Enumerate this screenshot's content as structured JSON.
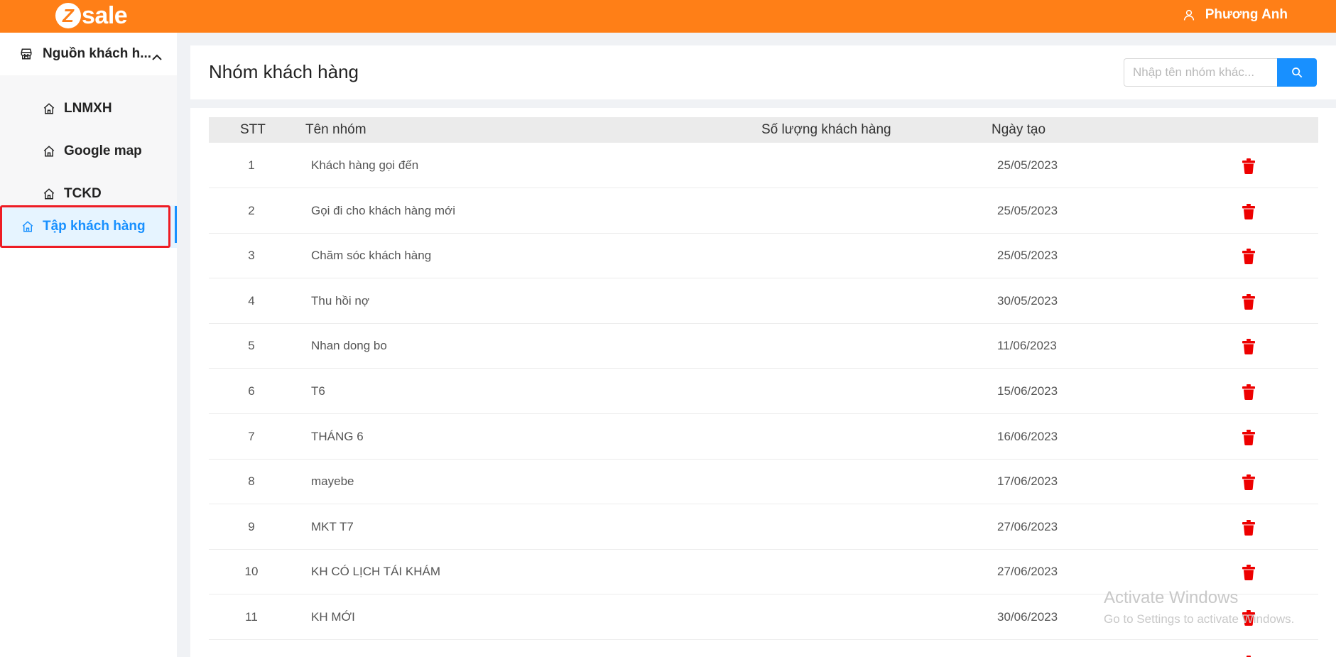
{
  "brand": {
    "logo_letter": "Z",
    "logo_text": "sale",
    "color": "#ff7f17"
  },
  "user": {
    "name": "Phương Anh",
    "icon": "user-icon"
  },
  "sidebar": {
    "group": {
      "label": "Nguồn khách h...",
      "icon": "store-icon",
      "expanded": true
    },
    "items": [
      {
        "label": "LNMXH",
        "icon": "home-icon"
      },
      {
        "label": "Google map",
        "icon": "home-icon"
      },
      {
        "label": "TCKD",
        "icon": "home-icon"
      }
    ],
    "active_item": {
      "label": "Tập khách hàng",
      "icon": "home-icon",
      "color": "#1890ff"
    }
  },
  "page": {
    "title": "Nhóm khách hàng",
    "search_placeholder": "Nhập tên nhóm khác..."
  },
  "table": {
    "columns": [
      "STT",
      "Tên nhóm",
      "Số lượng khách hàng",
      "Ngày tạo"
    ],
    "rows": [
      {
        "stt": "1",
        "name": "Khách hàng gọi đến",
        "count": "",
        "date": "25/05/2023"
      },
      {
        "stt": "2",
        "name": "Gọi đi cho khách hàng mới",
        "count": "",
        "date": "25/05/2023"
      },
      {
        "stt": "3",
        "name": "Chăm sóc khách hàng",
        "count": "",
        "date": "25/05/2023"
      },
      {
        "stt": "4",
        "name": "Thu hồi nợ",
        "count": "",
        "date": "30/05/2023"
      },
      {
        "stt": "5",
        "name": "Nhan dong bo",
        "count": "",
        "date": "11/06/2023"
      },
      {
        "stt": "6",
        "name": "T6",
        "count": "",
        "date": "15/06/2023"
      },
      {
        "stt": "7",
        "name": "THÁNG 6",
        "count": "",
        "date": "16/06/2023"
      },
      {
        "stt": "8",
        "name": "mayebe",
        "count": "",
        "date": "17/06/2023"
      },
      {
        "stt": "9",
        "name": "MKT T7",
        "count": "",
        "date": "27/06/2023"
      },
      {
        "stt": "10",
        "name": "KH CÓ LỊCH TÁI KHÁM",
        "count": "",
        "date": "27/06/2023"
      },
      {
        "stt": "11",
        "name": "KH MỚI",
        "count": "",
        "date": "30/06/2023"
      },
      {
        "stt": "",
        "name": "",
        "count": "",
        "date": ""
      }
    ],
    "delete_icon": "trash-icon",
    "delete_color": "#ee0000"
  },
  "watermark": {
    "line1": "Activate Windows",
    "line2": "Go to Settings to activate Windows."
  }
}
